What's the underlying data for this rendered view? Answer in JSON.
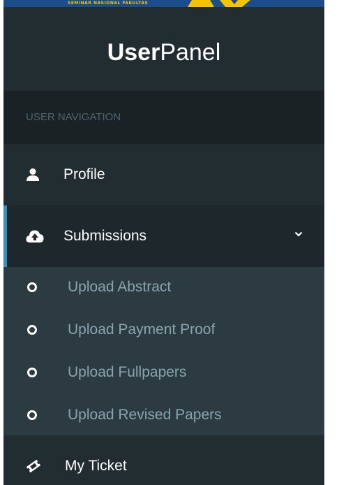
{
  "banner": {
    "text": "SEMINAR NASIONAL FAKULTAS"
  },
  "brand": {
    "bold": "User",
    "light": "Panel"
  },
  "nav": {
    "header": "USER NAVIGATION",
    "profile": {
      "label": "Profile",
      "icon": "user-icon"
    },
    "submissions": {
      "label": "Submissions",
      "icon": "cloud-upload-icon",
      "expanded": true,
      "children": [
        {
          "label": "Upload Abstract",
          "icon": "circle-outline-icon"
        },
        {
          "label": "Upload Payment Proof",
          "icon": "circle-outline-icon"
        },
        {
          "label": "Upload Fullpapers",
          "icon": "circle-outline-icon"
        },
        {
          "label": "Upload Revised Papers",
          "icon": "circle-outline-icon"
        }
      ]
    },
    "ticket": {
      "label": "My Ticket",
      "icon": "ticket-icon"
    }
  },
  "colors": {
    "sidebar_bg": "#222d32",
    "header_bg": "#1a2226",
    "active_bg": "#1e282c",
    "submenu_bg": "#2c3b41",
    "accent": "#3c8dbc",
    "submenu_text": "#8aa4af",
    "header_text": "#4b646f",
    "banner_bg": "#1a4d8a",
    "banner_yellow": "#f4c400"
  }
}
